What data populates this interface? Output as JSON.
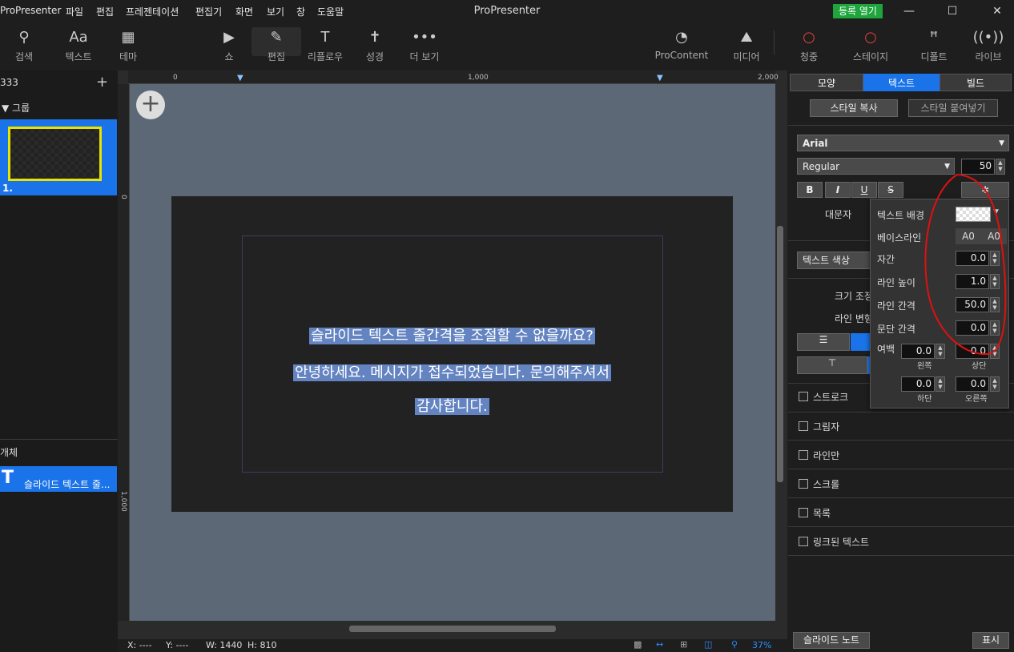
{
  "titlebar": {
    "app_name": "ProPresenter",
    "menus": [
      "파일",
      "편집",
      "프레젠테이션",
      "편집기",
      "화면",
      "보기",
      "창",
      "도움말"
    ],
    "title": "ProPresenter",
    "register_label": "등록 열기",
    "register_color": "#1ea53c"
  },
  "toolbar": {
    "search": "검색",
    "text": "텍스트",
    "text_icon_glyph": "Aa",
    "theme": "테마",
    "show": "쇼",
    "edit": "편집",
    "reflow": "리플로우",
    "bible": "성경",
    "more": "더 보기",
    "procontent": "ProContent",
    "media": "미디어",
    "audience": "청중",
    "stage": "스테이지",
    "props": "디폴트",
    "live": "라이브"
  },
  "left_panel": {
    "presentation_name": "333",
    "group_label": "그룹",
    "slide_number": "1.",
    "objects_header": "개체",
    "object_item": "슬라이드 텍스트 줄..."
  },
  "ruler": {
    "t0": "0",
    "t1": "1,000",
    "t2": "2,000",
    "v0": "0",
    "v1": "1,000"
  },
  "slide": {
    "lines": [
      "슬라이드 텍스트 줄간격을 조절할 수 없을까요?",
      "안녕하세요. 메시지가 접수되었습니다. 문의해주셔서",
      "감사합니다."
    ],
    "highlight_color": "#6384c1"
  },
  "right_panel": {
    "tabs": [
      "모양",
      "텍스트",
      "빌드"
    ],
    "copy_style": "스타일 복사",
    "paste_style": "스타일 붙여넣기",
    "font": "Arial",
    "weight": "Regular",
    "size": "50",
    "format_b": "B",
    "format_i": "I",
    "format_u": "U",
    "format_s": "S",
    "caps_label": "대문자",
    "text_color_label": "텍스트 색상",
    "scale_label": "크기 조정",
    "line_transform_label": "라인 변형",
    "sections": [
      "스트로크",
      "그림자",
      "라인만",
      "스크롤",
      "목록",
      "링크된 텍스트"
    ],
    "slide_notes": "슬라이드 노트",
    "show_btn": "표시"
  },
  "popup": {
    "text_bg": "텍스트 배경",
    "baseline": "베이스라인",
    "baseline_a": "A0",
    "baseline_b": "A0",
    "kerning": "자간",
    "kerning_val": "0.0",
    "line_height": "라인 높이",
    "line_height_val": "1.0",
    "line_spacing": "라인 간격",
    "line_spacing_val": "50.0",
    "para_spacing": "문단 간격",
    "para_spacing_val": "0.0",
    "margin": "여백",
    "m_left": "0.0",
    "m_left_lbl": "왼쪽",
    "m_top": "0.0",
    "m_top_lbl": "상단",
    "m_bottom": "0.0",
    "m_bottom_lbl": "하단",
    "m_right": "0.0",
    "m_right_lbl": "오른쪽"
  },
  "status": {
    "x": "X: ----",
    "y": "Y: ----",
    "w": "W: 1440",
    "h": "H: 810",
    "zoom": "37%"
  }
}
